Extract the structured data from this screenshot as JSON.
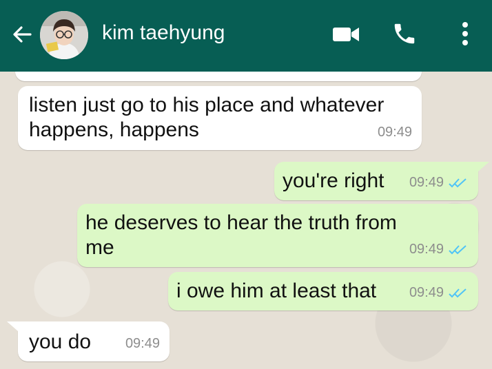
{
  "header": {
    "back_icon": "arrow-left-icon",
    "contact_name": "kim taehyung",
    "video_icon": "video-camera-icon",
    "call_icon": "phone-icon",
    "menu_icon": "more-vertical-icon",
    "bg_color": "#075e54"
  },
  "messages": [
    {
      "direction": "incoming",
      "text": "listen just go to his place and whatever\nhappens, happens",
      "time": "09:49"
    },
    {
      "direction": "outgoing",
      "text": "you're right",
      "time": "09:49",
      "status": "read"
    },
    {
      "direction": "outgoing",
      "text": "he deserves to hear the truth from\nme",
      "time": "09:49",
      "status": "read"
    },
    {
      "direction": "outgoing",
      "text": "i owe him at least that",
      "time": "09:49",
      "status": "read"
    },
    {
      "direction": "incoming",
      "text": "you do",
      "time": "09:49"
    }
  ],
  "colors": {
    "incoming_bubble": "#ffffff",
    "outgoing_bubble": "#dcf8c6",
    "read_ticks": "#4fc3f7",
    "chat_background": "#e6e0d6"
  }
}
